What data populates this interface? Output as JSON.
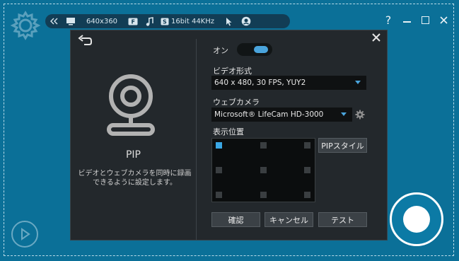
{
  "toolbar": {
    "resolution": "640x360",
    "audio_format": "16bit 44KHz",
    "icons": [
      "collapse-icon",
      "monitor-icon",
      "fps-icon",
      "music-icon",
      "speaker-icon",
      "cursor-icon",
      "webcam-icon"
    ]
  },
  "window_buttons": {
    "help": "?",
    "minimize": "—",
    "maximize": "□",
    "close": "✕"
  },
  "dialog": {
    "pip_title": "PIP",
    "pip_description": "ビデオとウェブカメラを同時に録画できるように設定します。",
    "toggle_label": "オン",
    "toggle_on": true,
    "video_format_label": "ビデオ形式",
    "video_format_value": "640 x 480, 30 FPS, YUY2",
    "webcam_label": "ウェブカメラ",
    "webcam_value": "Microsoft® LifeCam HD-3000",
    "position_label": "表示位置",
    "pip_style_button": "PIPスタイル",
    "selected_position": "top-left",
    "buttons": {
      "confirm": "確認",
      "cancel": "キャンセル",
      "test": "テスト"
    }
  },
  "colors": {
    "background": "#0b7098",
    "accent": "#4aa4dc",
    "dialog": "#23282c"
  }
}
